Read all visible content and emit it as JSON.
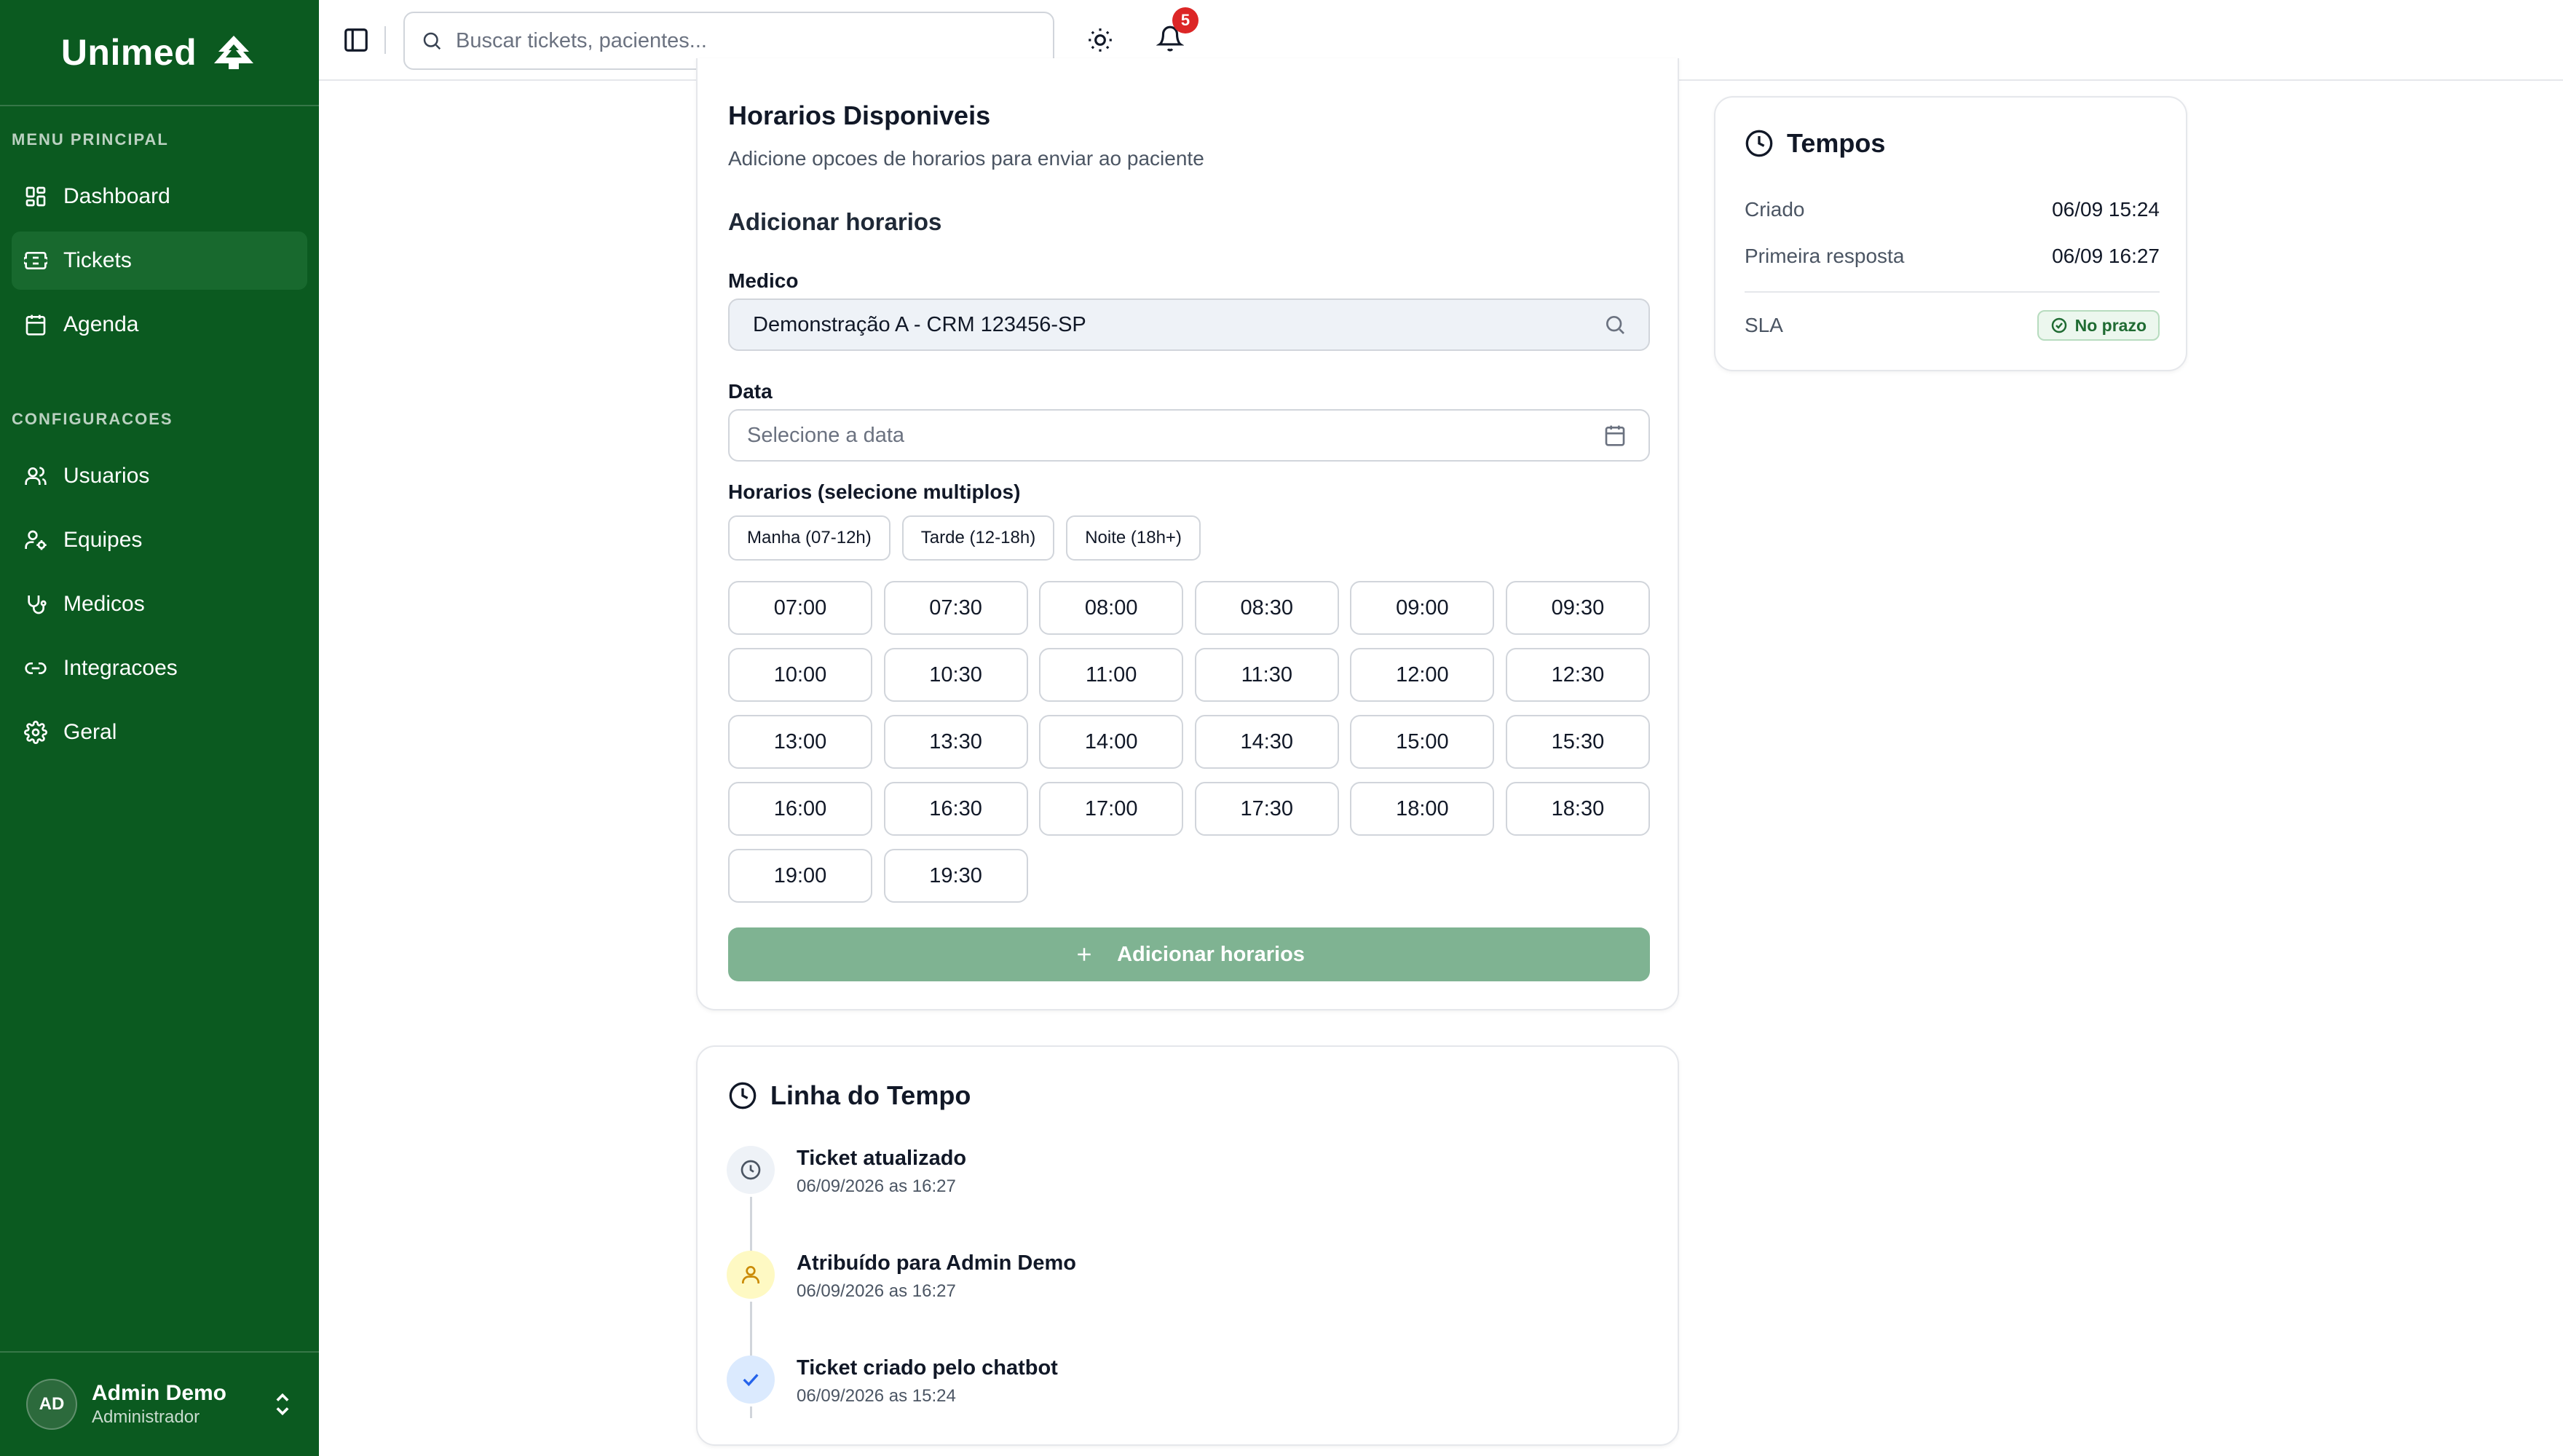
{
  "brand": {
    "name": "Unimed",
    "logo_icon": "unimed-tree-icon"
  },
  "sidebar": {
    "main_heading": "MENU PRINCIPAL",
    "main_items": [
      {
        "label": "Dashboard",
        "icon": "dashboard-icon"
      },
      {
        "label": "Tickets",
        "icon": "ticket-icon",
        "active": true
      },
      {
        "label": "Agenda",
        "icon": "calendar-icon"
      }
    ],
    "config_heading": "CONFIGURACOES",
    "config_items": [
      {
        "label": "Usuarios",
        "icon": "users-icon"
      },
      {
        "label": "Equipes",
        "icon": "team-icon"
      },
      {
        "label": "Medicos",
        "icon": "stethoscope-icon"
      },
      {
        "label": "Integracoes",
        "icon": "link-icon"
      },
      {
        "label": "Geral",
        "icon": "gear-icon"
      }
    ],
    "user": {
      "initials": "AD",
      "name": "Admin Demo",
      "role": "Administrador"
    }
  },
  "topbar": {
    "search_placeholder": "Buscar tickets, pacientes...",
    "notification_count": "5"
  },
  "horarios": {
    "title": "Horarios Disponiveis",
    "subtitle": "Adicione opcoes de horarios para enviar ao paciente",
    "section_title": "Adicionar horarios",
    "medico_label": "Medico",
    "medico_value": "Demonstração A - CRM 123456-SP",
    "data_label": "Data",
    "data_placeholder": "Selecione a data",
    "horarios_label": "Horarios (selecione multiplos)",
    "periods": [
      "Manha (07-12h)",
      "Tarde (12-18h)",
      "Noite (18h+)"
    ],
    "slots": [
      "07:00",
      "07:30",
      "08:00",
      "08:30",
      "09:00",
      "09:30",
      "10:00",
      "10:30",
      "11:00",
      "11:30",
      "12:00",
      "12:30",
      "13:00",
      "13:30",
      "14:00",
      "14:30",
      "15:00",
      "15:30",
      "16:00",
      "16:30",
      "17:00",
      "17:30",
      "18:00",
      "18:30",
      "19:00",
      "19:30"
    ],
    "add_button": "Adicionar horarios"
  },
  "timeline": {
    "title": "Linha do Tempo",
    "events": [
      {
        "event": "Ticket atualizado",
        "date": "06/09/2026 as 16:27",
        "icon": "clock-icon",
        "color": "#eef2f7"
      },
      {
        "event": "Atribuído para Admin Demo",
        "date": "06/09/2026 as 16:27",
        "icon": "user-icon",
        "color": "#fef9c3"
      },
      {
        "event": "Ticket criado pelo chatbot",
        "date": "06/09/2026 as 15:24",
        "icon": "check-icon",
        "color": "#dbeafe"
      }
    ]
  },
  "tempos": {
    "title": "Tempos",
    "criado_label": "Criado",
    "criado_value": "06/09 15:24",
    "primeira_label": "Primeira resposta",
    "primeira_value": "06/09 16:27",
    "sla_label": "SLA",
    "sla_status": "No prazo"
  },
  "colors": {
    "sidebar_bg": "#0b5a20",
    "sidebar_active": "#18692e",
    "accent_button": "#7fb392",
    "badge_red": "#dc2626"
  }
}
